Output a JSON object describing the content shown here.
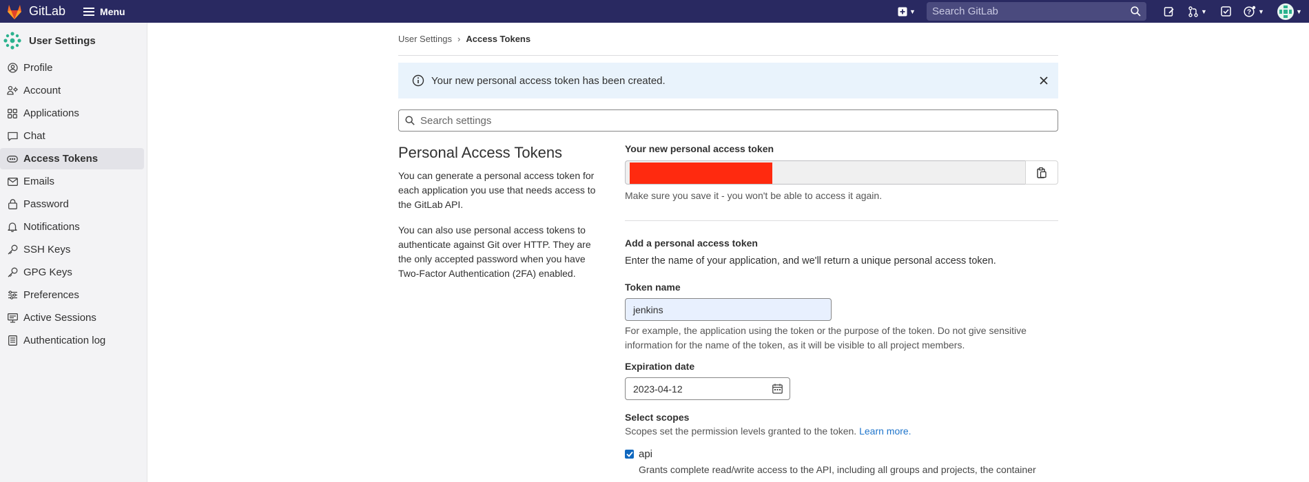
{
  "topbar": {
    "brand": "GitLab",
    "menu_label": "Menu",
    "search_placeholder": "Search GitLab"
  },
  "sidebar": {
    "title": "User Settings",
    "items": [
      {
        "label": "Profile",
        "icon": "profile-icon"
      },
      {
        "label": "Account",
        "icon": "account-icon"
      },
      {
        "label": "Applications",
        "icon": "applications-icon"
      },
      {
        "label": "Chat",
        "icon": "chat-icon"
      },
      {
        "label": "Access Tokens",
        "icon": "token-icon",
        "active": true
      },
      {
        "label": "Emails",
        "icon": "mail-icon"
      },
      {
        "label": "Password",
        "icon": "lock-icon"
      },
      {
        "label": "Notifications",
        "icon": "bell-icon"
      },
      {
        "label": "SSH Keys",
        "icon": "key-icon"
      },
      {
        "label": "GPG Keys",
        "icon": "key-icon"
      },
      {
        "label": "Preferences",
        "icon": "preferences-icon"
      },
      {
        "label": "Active Sessions",
        "icon": "monitor-icon"
      },
      {
        "label": "Authentication log",
        "icon": "log-icon"
      }
    ]
  },
  "breadcrumb": {
    "parent": "User Settings",
    "separator": "›",
    "current": "Access Tokens"
  },
  "alert": {
    "message": "Your new personal access token has been created."
  },
  "settings_search": {
    "placeholder": "Search settings"
  },
  "intro": {
    "title": "Personal Access Tokens",
    "paragraph1": "You can generate a personal access token for each application you use that needs access to the GitLab API.",
    "paragraph2": "You can also use personal access tokens to authenticate against Git over HTTP. They are the only accepted password when you have Two-Factor Authentication (2FA) enabled."
  },
  "new_token": {
    "label": "Your new personal access token",
    "help": "Make sure you save it - you won't be able to access it again."
  },
  "add_token": {
    "title": "Add a personal access token",
    "description": "Enter the name of your application, and we'll return a unique personal access token.",
    "name_label": "Token name",
    "name_value": "jenkins",
    "name_help": "For example, the application using the token or the purpose of the token. Do not give sensitive information for the name of the token, as it will be visible to all project members.",
    "expiration_label": "Expiration date",
    "expiration_value": "2023-04-12",
    "scopes_title": "Select scopes",
    "scopes_desc": "Scopes set the permission levels granted to the token.",
    "learn_more": "Learn more.",
    "scopes": [
      {
        "name": "api",
        "checked": true,
        "description": "Grants complete read/write access to the API, including all groups and projects, the container"
      }
    ]
  },
  "colors": {
    "topbar": "#292961",
    "sidebar": "#f3f3f5",
    "accent": "#1f75cb",
    "alert_bg": "#e9f3fc",
    "redaction": "#ff2a0f"
  }
}
